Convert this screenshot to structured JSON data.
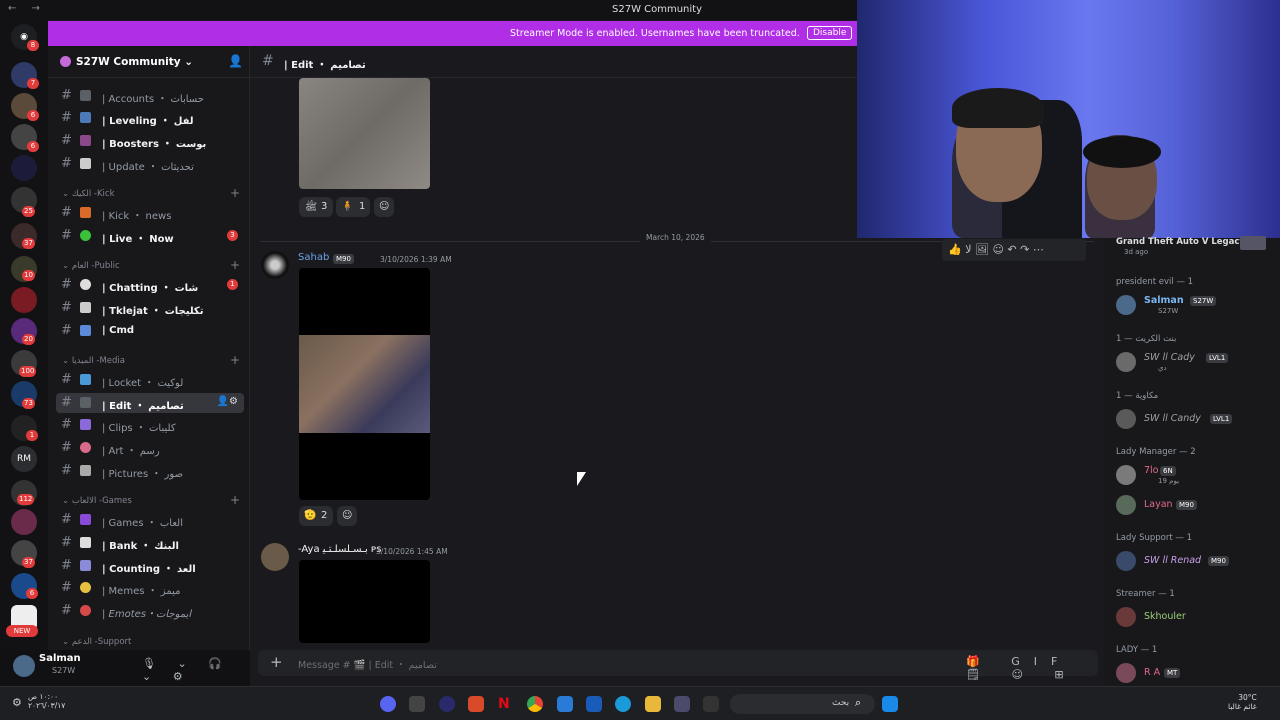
{
  "window": {
    "title": "S27W Community",
    "nav": "←  →"
  },
  "streamer": {
    "text": "Streamer Mode is enabled. Usernames have been truncated.",
    "disable": "Disable"
  },
  "rail": {
    "badges": [
      "8",
      "7",
      "6",
      "6",
      "25",
      "37",
      "10",
      "20",
      "100",
      "73",
      "1",
      "112",
      "37",
      "6"
    ],
    "rm": "RM",
    "new": "NEW"
  },
  "guild": {
    "name": "S27W Community ⌄"
  },
  "channels": [
    {
      "label": "| Accounts ・ حسابات",
      "bold": false
    },
    {
      "label": "| Leveling ・ لفل",
      "bold": true
    },
    {
      "label": "| Boosters ・ بوست",
      "bold": true
    },
    {
      "label": "| Update ・ تحديثات",
      "bold": false
    },
    {
      "label": "| Kick ・ news",
      "bold": false
    },
    {
      "label": "| Live ・ Now",
      "bold": true,
      "badge": "3"
    },
    {
      "label": "| Chatting ・ شات",
      "bold": true,
      "badge": "1"
    },
    {
      "label": "| Tklejat ・ تكليجات",
      "bold": true
    },
    {
      "label": "| Cmd",
      "bold": true
    },
    {
      "label": "| Locket ・ لوكيت",
      "bold": false
    },
    {
      "label": "| Edit ・ تصاميم",
      "bold": false,
      "selected": true
    },
    {
      "label": "| Clips ・ كليبات",
      "bold": false
    },
    {
      "label": "| Art ・ رسم",
      "bold": false
    },
    {
      "label": "| Pictures ・ صور",
      "bold": false
    },
    {
      "label": "| Games ・ العاب",
      "bold": false
    },
    {
      "label": "| Bank ・ البنك",
      "bold": true
    },
    {
      "label": "| Counting ・ العد",
      "bold": true
    },
    {
      "label": "| Memes ・ ميمز",
      "bold": false
    },
    {
      "label": "| Emotes・ايموجات",
      "bold": false
    }
  ],
  "categories": [
    "⌄ الكيك -Kick",
    "⌄ العام -Public",
    "⌄ الميديا -Media",
    "⌄ الالعاب -Games",
    "⌄ الدعم -Support"
  ],
  "user": {
    "name": "Salman",
    "status": "S27W",
    "controls": "🎙 ⌄ 🎧 ⌄ ⚙"
  },
  "header": {
    "channel": "| Edit ・ تصاميم"
  },
  "messages": [
    {
      "reactions": [
        {
          "emoji": "ﷺ",
          "count": "3"
        },
        {
          "emoji": "🧍",
          "count": "1"
        }
      ]
    },
    {
      "author": "Sahab",
      "tag": "M90",
      "time": "3/10/2026 1:39 AM",
      "reactions": [
        {
          "emoji": "🫡",
          "count": "2"
        }
      ]
    },
    {
      "author": "-Aya ﺑـﺴـﻠﺴﻠـﺘـﻴ ᴘs",
      "time": "3/10/2026 1:45 AM"
    }
  ],
  "date_divider": "March 10, 2026",
  "toolbar": {
    "icons": "👍 لا 🖼 ☺ ↶ ↷ ⋯"
  },
  "input": {
    "placeholder": "Message # 🎬 | Edit ・ تصاميم",
    "icons": "🎁 GIF 🗒 ☺ ⊞"
  },
  "members": {
    "activity": {
      "title": "Grand Theft Auto V Legacy",
      "sub": "3d ago"
    },
    "groups": [
      {
        "header": "president evil — 1",
        "members": [
          {
            "name": "Salman",
            "tag": "S27W",
            "sub": "S27W",
            "color": "#79b8f0"
          }
        ]
      },
      {
        "header": "بنت الكريت — 1",
        "members": [
          {
            "name": "SW ll Cady",
            "tag": "LVL1",
            "sub": "دي",
            "color": "#a0a0a0"
          }
        ]
      },
      {
        "header": "مكاوية — 1",
        "members": [
          {
            "name": "SW ll Candy",
            "tag": "LVL1",
            "sub": "",
            "color": "#a0a0a0"
          }
        ]
      },
      {
        "header": "Lady Manager — 2",
        "members": [
          {
            "name": "7lo",
            "tag": "6N",
            "sub": "يوم 19",
            "color": "#e06a8a"
          },
          {
            "name": "Layan",
            "tag": "M90",
            "sub": "",
            "color": "#e06a8a"
          }
        ]
      },
      {
        "header": "Lady Support — 1",
        "members": [
          {
            "name": "SW ll Renad",
            "tag": "M90",
            "sub": "",
            "color": "#c8a0e8"
          }
        ]
      },
      {
        "header": "Streamer — 1",
        "members": [
          {
            "name": "Skhouler",
            "tag": "",
            "sub": "",
            "color": "#9bd07a"
          }
        ]
      },
      {
        "header": "LADY — 1",
        "members": [
          {
            "name": "R A",
            "tag": "MT",
            "sub": "",
            "color": "#e06a8a"
          }
        ]
      }
    ]
  },
  "taskbar": {
    "time": "١٠:٠٠ ص",
    "date": "٢٠٢٦/٠٣/١٧",
    "search": "بحث",
    "weather_temp": "30°C",
    "weather_text": "غائم غالبا"
  }
}
